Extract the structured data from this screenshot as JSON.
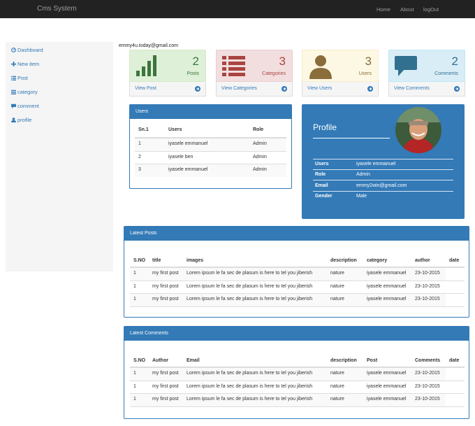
{
  "navbar": {
    "brand": "Cms System",
    "links": [
      "Home",
      "About",
      "logOut"
    ]
  },
  "sidebar": {
    "items": [
      {
        "label": "Dashboard",
        "icon": "dashboard-icon"
      },
      {
        "label": "New item",
        "icon": "plus-icon"
      },
      {
        "label": "Post",
        "icon": "list-icon"
      },
      {
        "label": "category",
        "icon": "list-icon"
      },
      {
        "label": "comment",
        "icon": "comment-icon"
      },
      {
        "label": "profile",
        "icon": "user-icon"
      }
    ]
  },
  "user_email": "emmy4u.today@gmail.com",
  "cards": [
    {
      "count": "2",
      "label": "Posts",
      "link": "View Post",
      "icon": "bar-chart-icon",
      "color": "#3c763d",
      "bg": "#dff0d8"
    },
    {
      "count": "3",
      "label": "Categories",
      "link": "View Categories",
      "icon": "list-icon",
      "color": "#a94442",
      "bg": "#f2dede"
    },
    {
      "count": "3",
      "label": "Users",
      "link": "View Users",
      "icon": "user-icon",
      "color": "#8a6d3b",
      "bg": "#fcf8e3"
    },
    {
      "count": "2",
      "label": "Comments",
      "link": "View Comments",
      "icon": "comment-icon",
      "color": "#31708f",
      "bg": "#d9edf7"
    }
  ],
  "users_panel": {
    "title": "Users",
    "headers": [
      "Sn.1",
      "Users",
      "Role"
    ],
    "rows": [
      [
        "1",
        "iyasele emmanuel",
        "Admin"
      ],
      [
        "2",
        "iyasele ben",
        "Admin"
      ],
      [
        "3",
        "iyasele emmanuel",
        "Admin"
      ]
    ]
  },
  "profile": {
    "title": "Profile",
    "fields": [
      {
        "key": "Users",
        "value": "iyasele emmanuel"
      },
      {
        "key": "Role",
        "value": "Admin"
      },
      {
        "key": "Email",
        "value": "emmy2win@gmail.com"
      },
      {
        "key": "Gender",
        "value": "Male"
      }
    ]
  },
  "latest_posts": {
    "title": "Latest Posts",
    "headers": [
      "S.NO",
      "title",
      "images",
      "description",
      "category",
      "author",
      "date"
    ],
    "rows": [
      [
        "1",
        "my first post",
        "Lorem ipsum le fa sec de plasum is here to tel you jiberish",
        "nature",
        "iyasele emmanuel",
        "23-10-2015"
      ],
      [
        "1",
        "my first post",
        "Lorem ipsum le fa sec de plasum is here to tel you jiberish",
        "nature",
        "iyasele emmanuel",
        "23-10-2015"
      ],
      [
        "1",
        "my first post",
        "Lorem ipsum le fa sec de plasum is here to tel you jiberish",
        "nature",
        "iyasele emmanuel",
        "23-10-2015"
      ]
    ]
  },
  "latest_comments": {
    "title": "Latest Comments",
    "headers": [
      "S.NO",
      "Author",
      "Email",
      "description",
      "Post",
      "Comments",
      "date"
    ],
    "rows": [
      [
        "1",
        "my first post",
        "Lorem ipsum le fa sec de plasum is here to tel you jiberish",
        "nature",
        "iyasele emmanuel",
        "23-10-2015"
      ],
      [
        "1",
        "my first post",
        "Lorem ipsum le fa sec de plasum is here to tel you jiberish",
        "nature",
        "iyasele emmanuel",
        "23-10-2015"
      ],
      [
        "1",
        "my first post",
        "Lorem ipsum le fa sec de plasum is here to tel you jiberish",
        "nature",
        "iyasele emmanuel",
        "23-10-2015"
      ]
    ]
  },
  "colors": {
    "primary": "#337ab7",
    "navbar": "#222222"
  }
}
